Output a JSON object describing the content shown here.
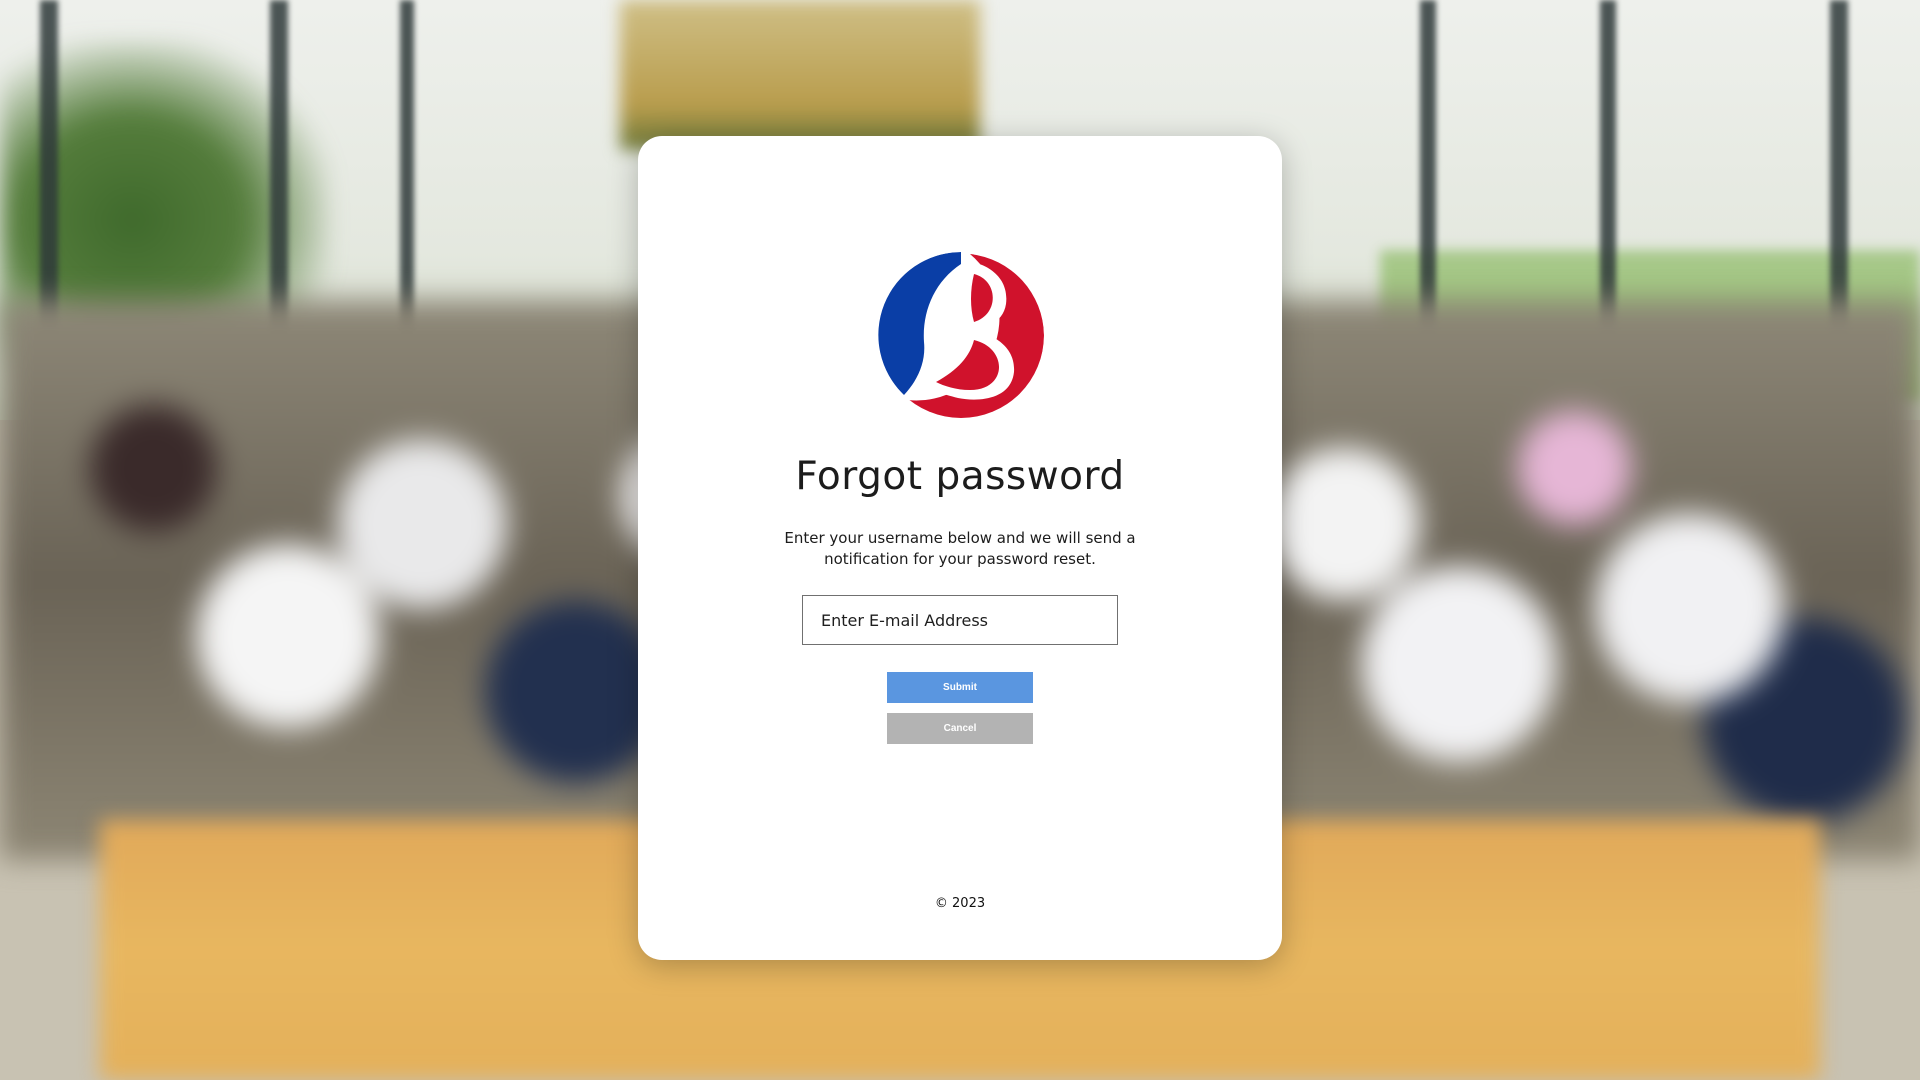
{
  "page": {
    "title": "Forgot password",
    "description": "Enter your username below and we will send a notification for your password reset.",
    "footer": "© 2023"
  },
  "form": {
    "email_placeholder": "Enter E-mail Address",
    "email_value": "",
    "submit_label": "Submit",
    "cancel_label": "Cancel"
  },
  "theme": {
    "logo_blue": "#0a3ea6",
    "logo_red": "#d0122c",
    "submit_color": "#5a96e0",
    "cancel_color": "#b3b3b3"
  },
  "icons": {
    "logo": "brand-logo-icon"
  }
}
